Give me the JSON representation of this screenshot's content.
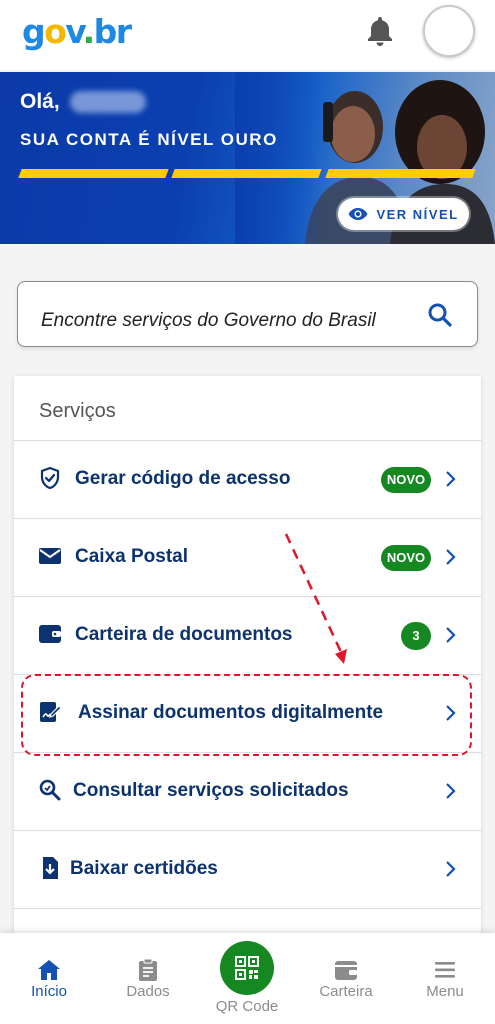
{
  "header": {
    "logo": {
      "g": "g",
      "o": "o",
      "v": "v",
      "dot": ".",
      "br": "br"
    }
  },
  "banner": {
    "greeting": "Olá,",
    "level_prefix": "SUA CONTA É NÍVEL ",
    "level_value": "OURO",
    "see_level_label": "VER NÍVEL"
  },
  "search": {
    "placeholder": "Encontre serviços do Governo do Brasil"
  },
  "services": {
    "title": "Serviços",
    "items": [
      {
        "label": "Gerar código de acesso",
        "icon": "shield-check-icon",
        "badge": "NOVO"
      },
      {
        "label": "Caixa Postal",
        "icon": "envelope-icon",
        "badge": "NOVO"
      },
      {
        "label": "Carteira de documentos",
        "icon": "wallet-icon",
        "badge": "3"
      },
      {
        "label": "Assinar documentos digitalmente",
        "icon": "signature-icon"
      },
      {
        "label": "Consultar serviços solicitados",
        "icon": "search-document-icon"
      },
      {
        "label": "Baixar certidões",
        "icon": "download-file-icon"
      }
    ]
  },
  "bottom_nav": {
    "items": [
      {
        "label": "Início",
        "icon": "home-icon"
      },
      {
        "label": "Dados",
        "icon": "clipboard-icon"
      },
      {
        "label": "QR Code",
        "icon": "qr-code-icon"
      },
      {
        "label": "Carteira",
        "icon": "wallet-icon"
      },
      {
        "label": "Menu",
        "icon": "hamburger-icon"
      }
    ]
  },
  "colors": {
    "brand_blue": "#1351b4",
    "dark_blue": "#0c326f",
    "green": "#168821",
    "gold": "#ffcd07",
    "highlight_red": "#e0142b"
  }
}
